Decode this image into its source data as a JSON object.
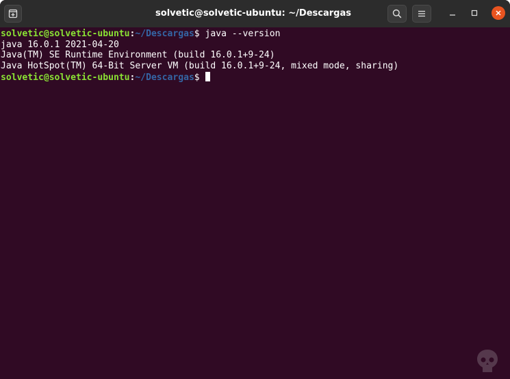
{
  "window": {
    "title": "solvetic@solvetic-ubuntu: ~/Descargas"
  },
  "colors": {
    "terminal_bg": "#300a24",
    "prompt_user": "#8ae234",
    "prompt_path": "#3465a4",
    "close_button": "#e95420"
  },
  "icons": {
    "new_tab": "new-tab-icon",
    "search": "search-icon",
    "menu": "hamburger-menu-icon",
    "minimize": "minimize-icon",
    "maximize": "maximize-icon",
    "close": "close-icon"
  },
  "terminal": {
    "prompt1": {
      "user_host": "solvetic@solvetic-ubuntu",
      "colon": ":",
      "path": "~/Descargas",
      "symbol": "$",
      "command": " java --version"
    },
    "output": [
      "java 16.0.1 2021-04-20",
      "Java(TM) SE Runtime Environment (build 16.0.1+9-24)",
      "Java HotSpot(TM) 64-Bit Server VM (build 16.0.1+9-24, mixed mode, sharing)"
    ],
    "prompt2": {
      "user_host": "solvetic@solvetic-ubuntu",
      "colon": ":",
      "path": "~/Descargas",
      "symbol": "$ "
    }
  }
}
